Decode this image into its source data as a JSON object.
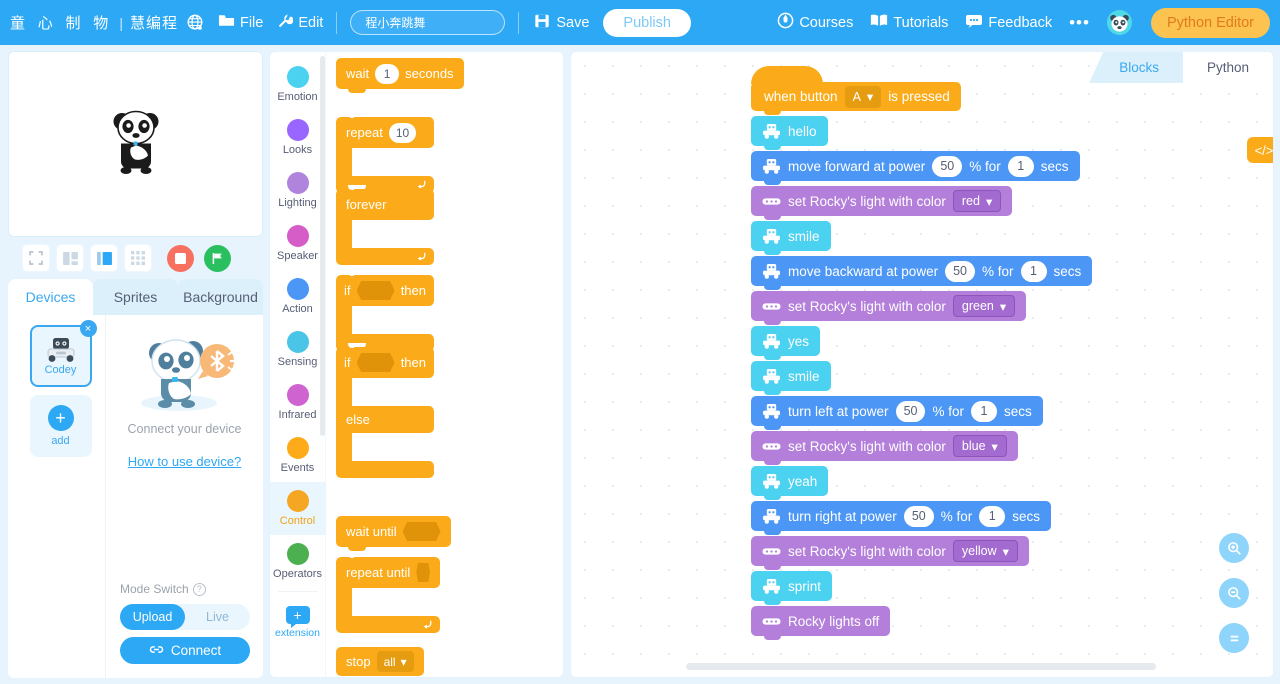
{
  "header": {
    "brand_cn": "童 心 制 物",
    "brand_divider": "|",
    "brand_cn2": "慧编程",
    "globe_icon": "globe-icon",
    "file_label": "File",
    "file_icon": "folder-icon",
    "edit_label": "Edit",
    "edit_icon": "wrench-icon",
    "project_name": "程小奔跳舞",
    "project_placeholder": "程小奔跳舞",
    "save_label": "Save",
    "save_icon": "floppy-disk-icon",
    "publish_label": "Publish",
    "courses_label": "Courses",
    "courses_icon": "compass-icon",
    "tutorials_label": "Tutorials",
    "tutorials_icon": "book-icon",
    "feedback_label": "Feedback",
    "feedback_icon": "chat-icon",
    "more_label": "•••",
    "avatar_icon": "panda-avatar-icon",
    "python_editor_label": "Python Editor",
    "accent_blue": "#2da8f5",
    "accent_yellow": "#fcc350"
  },
  "stage": {
    "sprite_icon": "panda-sprite",
    "layout_buttons": [
      {
        "name": "fullscreen-layout-button",
        "icon": "fullscreen-icon"
      },
      {
        "name": "small-stage-layout-button",
        "icon": "small-stage-icon"
      },
      {
        "name": "large-stage-layout-button",
        "icon": "large-stage-icon"
      },
      {
        "name": "grid-layout-button",
        "icon": "grid-icon"
      }
    ],
    "stop_icon": "stop-icon",
    "play_icon": "green-flag-icon"
  },
  "left_tabs": [
    {
      "label": "Devices",
      "active": true
    },
    {
      "label": "Sprites",
      "active": false
    },
    {
      "label": "Background",
      "active": false
    }
  ],
  "devices_panel": {
    "device_name": "Codey",
    "device_icon": "codey-robot-icon",
    "device_close_icon": "×",
    "add_label": "add",
    "add_icon": "+",
    "connect_illustration": "panda-with-bluetooth-icon",
    "connect_prompt": "Connect your device",
    "how_to_link": "How to use device?",
    "mode_switch_label": "Mode Switch",
    "mode_help_icon": "question-icon",
    "mode_options": [
      {
        "label": "Upload",
        "active": true
      },
      {
        "label": "Live",
        "active": false
      }
    ],
    "connect_button": "Connect",
    "connect_button_icon": "link-icon"
  },
  "categories": [
    {
      "label": "Emotion",
      "color": "#4ad2f0",
      "selected": false
    },
    {
      "label": "Looks",
      "color": "#9966ff",
      "selected": false
    },
    {
      "label": "Lighting",
      "color": "#b084dd",
      "selected": false
    },
    {
      "label": "Speaker",
      "color": "#d65cc8",
      "selected": false
    },
    {
      "label": "Action",
      "color": "#4c97f5",
      "selected": false
    },
    {
      "label": "Sensing",
      "color": "#4ac5e8",
      "selected": false
    },
    {
      "label": "Infrared",
      "color": "#cf63cf",
      "selected": false
    },
    {
      "label": "Events",
      "color": "#ffab19",
      "selected": false
    },
    {
      "label": "Control",
      "color": "#f5a623",
      "selected": true
    },
    {
      "label": "Operators",
      "color": "#4caf50",
      "selected": false
    }
  ],
  "extension": {
    "label": "extension",
    "icon": "+"
  },
  "palette_blocks": [
    {
      "type": "stack",
      "name": "wait-block",
      "parts": [
        "wait",
        "1",
        "seconds"
      ]
    },
    {
      "type": "c",
      "name": "repeat-block",
      "parts": [
        "repeat",
        "10"
      ],
      "loop_icon": "loop-arrow-icon"
    },
    {
      "type": "c",
      "name": "forever-block",
      "parts": [
        "forever"
      ],
      "loop_icon": "loop-arrow-icon"
    },
    {
      "type": "c",
      "name": "if-then-block",
      "parts": [
        "if",
        "then"
      ]
    },
    {
      "type": "c-else",
      "name": "if-then-else-block",
      "parts": [
        "if",
        "then",
        "else"
      ]
    },
    {
      "type": "stack",
      "name": "wait-until-block",
      "parts": [
        "wait until"
      ]
    },
    {
      "type": "c",
      "name": "repeat-until-block",
      "parts": [
        "repeat until"
      ],
      "loop_icon": "loop-arrow-icon"
    },
    {
      "type": "stack",
      "name": "stop-block",
      "parts": [
        "stop",
        "all"
      ]
    }
  ],
  "code_tabs": [
    {
      "label": "Blocks",
      "active": true
    },
    {
      "label": "Python",
      "active": false
    }
  ],
  "canvas": {
    "code_view_icon": "</>",
    "zoom_in_icon": "zoom-in-icon",
    "zoom_out_icon": "zoom-out-icon",
    "zoom_reset_icon": "zoom-reset-icon"
  },
  "script": [
    {
      "kind": "hat",
      "name": "when-button-pressed-block",
      "text_before": "when button",
      "dropdown": "A",
      "text_after": "is pressed"
    },
    {
      "kind": "emotion",
      "name": "hello-block",
      "icon": "codey-face-icon",
      "label": "hello"
    },
    {
      "kind": "action",
      "name": "move-forward-block",
      "icon": "codey-face-icon",
      "label": "move forward at power",
      "power": "50",
      "mid": "% for",
      "secs": "1",
      "unit": "secs"
    },
    {
      "kind": "light",
      "name": "set-light-color-red-block",
      "icon": "led-strip-icon",
      "label": "set Rocky's light with color",
      "dropdown": "red"
    },
    {
      "kind": "emotion",
      "name": "smile-block",
      "icon": "codey-face-icon",
      "label": "smile"
    },
    {
      "kind": "action",
      "name": "move-backward-block",
      "icon": "codey-face-icon",
      "label": "move backward at power",
      "power": "50",
      "mid": "% for",
      "secs": "1",
      "unit": "secs"
    },
    {
      "kind": "light",
      "name": "set-light-color-green-block",
      "icon": "led-strip-icon",
      "label": "set Rocky's light with color",
      "dropdown": "green"
    },
    {
      "kind": "emotion",
      "name": "yes-block",
      "icon": "codey-face-icon",
      "label": "yes"
    },
    {
      "kind": "emotion",
      "name": "smile-block-2",
      "icon": "codey-face-icon",
      "label": "smile"
    },
    {
      "kind": "action",
      "name": "turn-left-block",
      "icon": "codey-face-icon",
      "label": "turn left at power",
      "power": "50",
      "mid": "% for",
      "secs": "1",
      "unit": "secs"
    },
    {
      "kind": "light",
      "name": "set-light-color-blue-block",
      "icon": "led-strip-icon",
      "label": "set Rocky's light with color",
      "dropdown": "blue"
    },
    {
      "kind": "emotion",
      "name": "yeah-block",
      "icon": "codey-face-icon",
      "label": "yeah"
    },
    {
      "kind": "action",
      "name": "turn-right-block",
      "icon": "codey-face-icon",
      "label": "turn right at power",
      "power": "50",
      "mid": "% for",
      "secs": "1",
      "unit": "secs"
    },
    {
      "kind": "light",
      "name": "set-light-color-yellow-block",
      "icon": "led-strip-icon",
      "label": "set Rocky's light with color",
      "dropdown": "yellow"
    },
    {
      "kind": "emotion",
      "name": "sprint-block",
      "icon": "codey-face-icon",
      "label": "sprint"
    },
    {
      "kind": "light",
      "name": "rocky-lights-off-block",
      "icon": "led-strip-icon",
      "label": "Rocky lights off"
    }
  ]
}
